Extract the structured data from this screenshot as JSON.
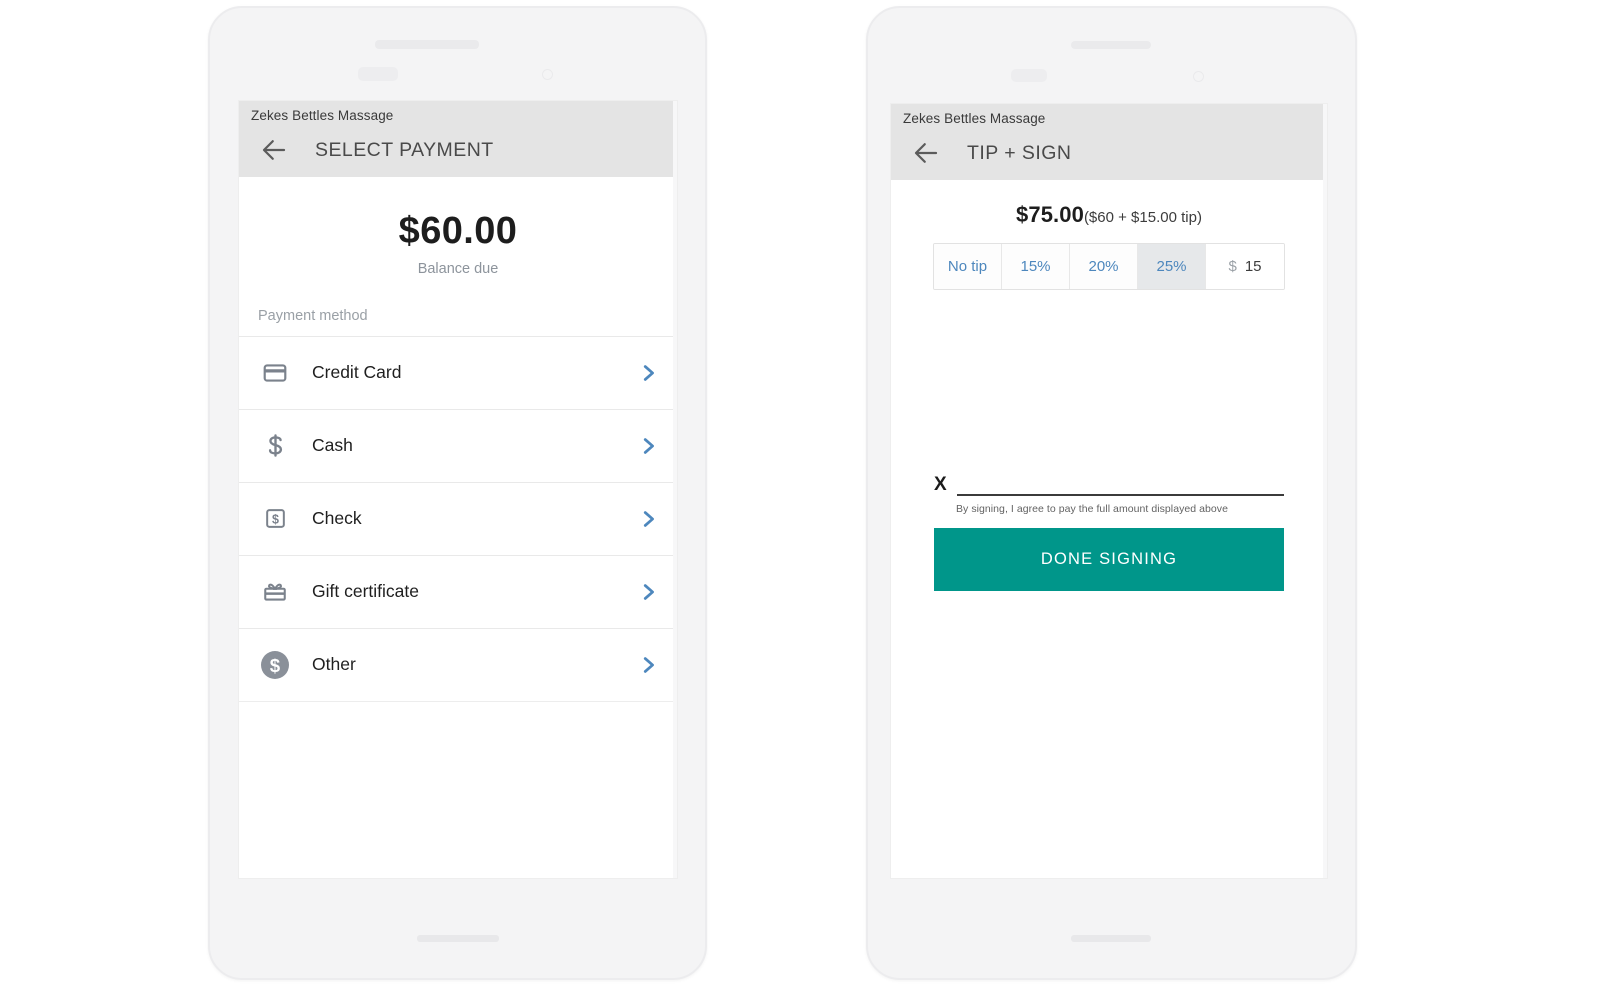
{
  "theme": {
    "teal": "#00968a",
    "chevron_blue": "#4d87bd",
    "appbar_gray": "#e4e4e4",
    "icon_gray": "#7b828c",
    "muted_text": "#9aa0a6"
  },
  "phone_left": {
    "business_name": "Zekes Bettles Massage",
    "back_icon": "arrow-left-icon",
    "title": "SELECT PAYMENT",
    "amount": "$60.00",
    "amount_caption": "Balance due",
    "section_label": "Payment method",
    "payment_methods": [
      {
        "label": "Credit Card",
        "icon": "credit-card-icon",
        "chevron": "chevron-right-icon"
      },
      {
        "label": "Cash",
        "icon": "dollar-sign-icon",
        "chevron": "chevron-right-icon"
      },
      {
        "label": "Check",
        "icon": "check-square-icon",
        "chevron": "chevron-right-icon"
      },
      {
        "label": "Gift certificate",
        "icon": "gift-icon",
        "chevron": "chevron-right-icon"
      },
      {
        "label": "Other",
        "icon": "dollar-circle-icon",
        "chevron": "chevron-right-icon"
      }
    ]
  },
  "phone_right": {
    "business_name": "Zekes Bettles Massage",
    "back_icon": "arrow-left-icon",
    "title": "TIP + SIGN",
    "total_main": "$75.00",
    "total_detail": "($60 + $15.00 tip)",
    "tip_options": [
      {
        "label": "No tip",
        "selected": false
      },
      {
        "label": "15%",
        "selected": false
      },
      {
        "label": "20%",
        "selected": false
      },
      {
        "label": "25%",
        "selected": true
      }
    ],
    "tip_amount": {
      "currency": "$",
      "value": "15"
    },
    "signature_marker": "X",
    "signature_legal": "By signing, I agree to pay the full amount displayed above",
    "done_button": "DONE SIGNING"
  }
}
